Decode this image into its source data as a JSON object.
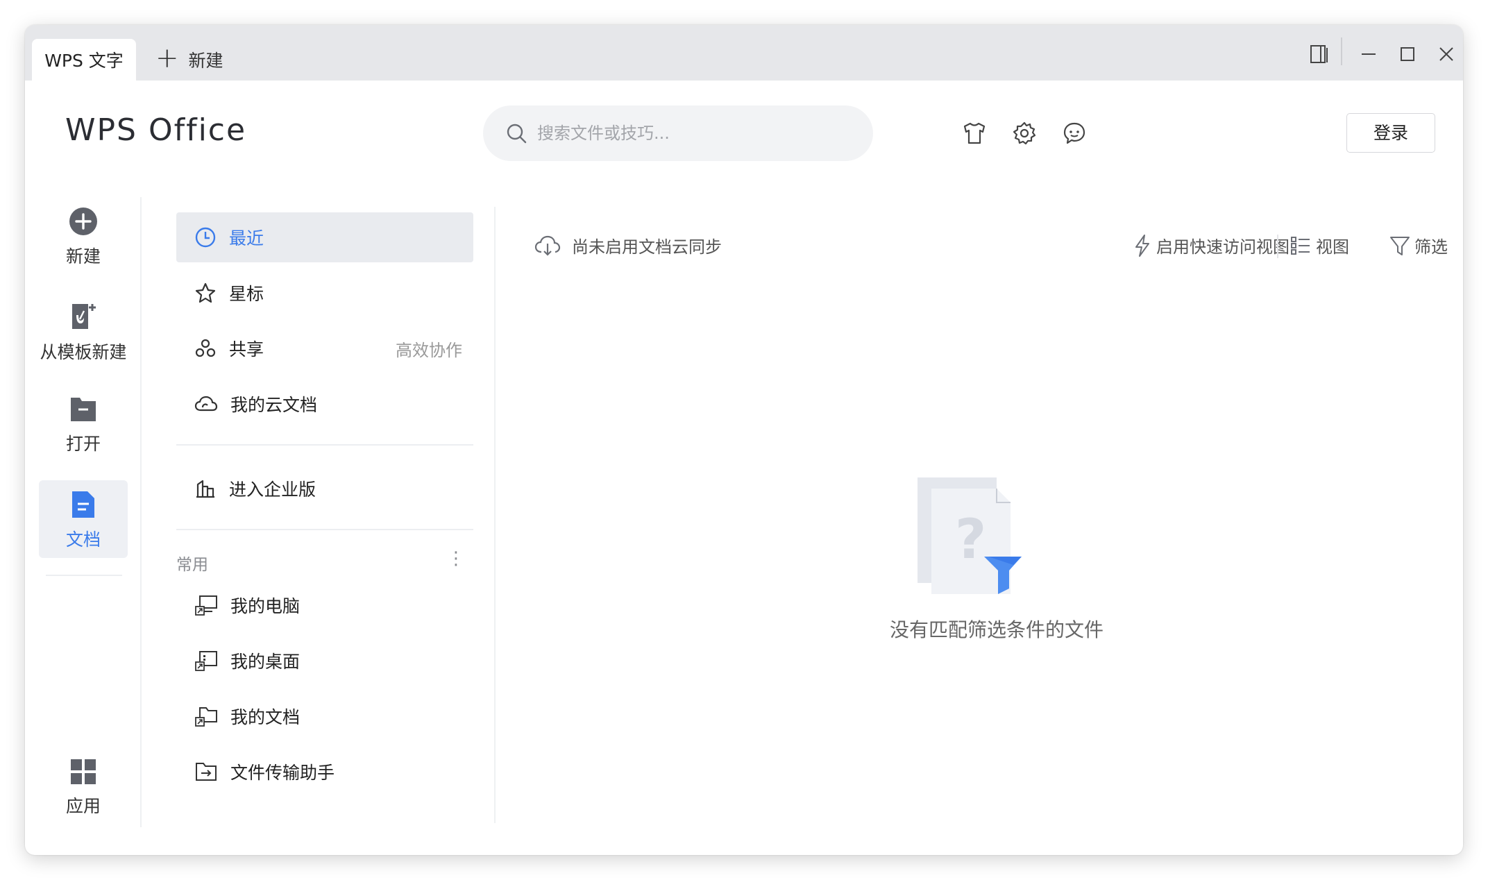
{
  "titlebar": {
    "active_tab": "WPS 文字",
    "new_tab": "新建"
  },
  "header": {
    "logo_text": "WPS Office",
    "search_placeholder": "搜索文件或技巧...",
    "icons": [
      "skin-icon",
      "settings-icon",
      "feedback-icon"
    ],
    "login_label": "登录"
  },
  "rail": {
    "items": [
      {
        "label": "新建",
        "icon": "plus-circle-icon"
      },
      {
        "label": "从模板新建",
        "icon": "template-icon"
      },
      {
        "label": "打开",
        "icon": "folder-icon"
      },
      {
        "label": "文档",
        "icon": "document-icon",
        "active": true
      }
    ],
    "bottom": {
      "label": "应用",
      "icon": "apps-grid-icon"
    }
  },
  "nav": {
    "items": [
      {
        "label": "最近",
        "icon": "clock-icon",
        "active": true
      },
      {
        "label": "星标",
        "icon": "star-icon"
      },
      {
        "label": "共享",
        "icon": "share-icon",
        "aside": "高效协作"
      },
      {
        "label": "我的云文档",
        "icon": "cloud-icon"
      }
    ],
    "enterprise": {
      "label": "进入企业版",
      "icon": "building-icon"
    },
    "section_label": "常用",
    "common": [
      {
        "label": "我的电脑",
        "icon": "computer-shortcut-icon"
      },
      {
        "label": "我的桌面",
        "icon": "desktop-shortcut-icon"
      },
      {
        "label": "我的文档",
        "icon": "documents-folder-shortcut-icon"
      },
      {
        "label": "文件传输助手",
        "icon": "file-transfer-icon"
      }
    ]
  },
  "content": {
    "sync_status": "尚未启用文档云同步",
    "toolbar": {
      "quick_access": "启用快速访问视图",
      "view": "视图",
      "filter": "筛选"
    },
    "empty_message": "没有匹配筛选条件的文件"
  },
  "colors": {
    "accent": "#3a7bea",
    "titlebar_bg": "#e6e7ea",
    "icon_gray": "#6b6e75"
  }
}
